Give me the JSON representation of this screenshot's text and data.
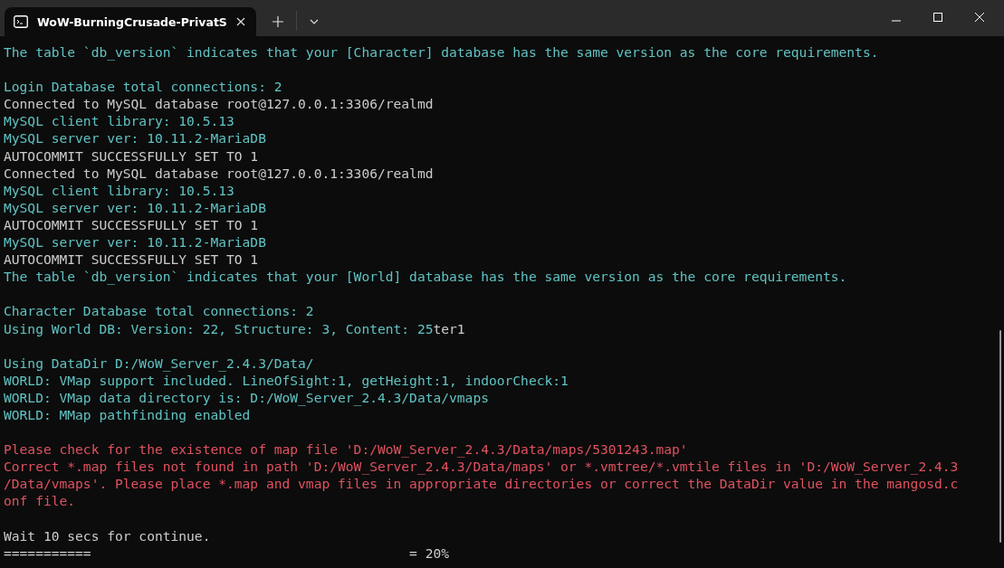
{
  "window": {
    "tab_title": "WoW-BurningCrusade-PrivatS"
  },
  "console_lines": [
    {
      "kind": "info",
      "segments": [
        {
          "text": "The table `db_version` indicates that your [Character] database has the same version as the core requirements.",
          "kind": "info"
        }
      ]
    },
    {
      "kind": "blank"
    },
    {
      "kind": "line",
      "segments": [
        {
          "text": "Login Database total connections: 2",
          "kind": "info"
        }
      ]
    },
    {
      "kind": "line",
      "segments": [
        {
          "text": "Connected to MySQL database root@127.0.0.1:3306/realmd",
          "kind": "plain"
        }
      ]
    },
    {
      "kind": "line",
      "segments": [
        {
          "text": "MySQL client library: 10.5.13",
          "kind": "info"
        }
      ]
    },
    {
      "kind": "line",
      "segments": [
        {
          "text": "MySQL server ver: 10.11.2-MariaDB",
          "kind": "info"
        }
      ]
    },
    {
      "kind": "line",
      "segments": [
        {
          "text": "AUTOCOMMIT SUCCESSFULLY SET TO 1",
          "kind": "plain"
        }
      ]
    },
    {
      "kind": "line",
      "segments": [
        {
          "text": "Connected to MySQL database root@127.0.0.1:3306/realmd",
          "kind": "plain"
        }
      ]
    },
    {
      "kind": "line",
      "segments": [
        {
          "text": "MySQL client library: 10.5.13",
          "kind": "info"
        }
      ]
    },
    {
      "kind": "line",
      "segments": [
        {
          "text": "MySQL server ver: 10.11.2-MariaDB",
          "kind": "info"
        }
      ]
    },
    {
      "kind": "line",
      "segments": [
        {
          "text": "AUTOCOMMIT SUCCESSFULLY SET TO 1",
          "kind": "plain"
        }
      ]
    },
    {
      "kind": "line",
      "segments": [
        {
          "text": "MySQL server ver: 10.11.2-MariaDB",
          "kind": "info"
        }
      ]
    },
    {
      "kind": "line",
      "segments": [
        {
          "text": "AUTOCOMMIT SUCCESSFULLY SET TO 1",
          "kind": "plain"
        }
      ]
    },
    {
      "kind": "line",
      "segments": [
        {
          "text": "The table `db_version` indicates that your [World] database has the same version as the core requirements.",
          "kind": "info"
        }
      ]
    },
    {
      "kind": "blank"
    },
    {
      "kind": "line",
      "segments": [
        {
          "text": "Character Database total connections: 2",
          "kind": "info"
        }
      ]
    },
    {
      "kind": "line",
      "segments": [
        {
          "text": "Using World DB: Version: 22, Structure: 3, Content: 25",
          "kind": "info"
        },
        {
          "text": "ter1",
          "kind": "plain"
        }
      ]
    },
    {
      "kind": "blank"
    },
    {
      "kind": "line",
      "segments": [
        {
          "text": "Using DataDir D:/WoW_Server_2.4.3/Data/",
          "kind": "info"
        }
      ]
    },
    {
      "kind": "line",
      "segments": [
        {
          "text": "WORLD: VMap support included. LineOfSight:1, getHeight:1, indoorCheck:1",
          "kind": "info"
        }
      ]
    },
    {
      "kind": "line",
      "segments": [
        {
          "text": "WORLD: VMap data directory is: D:/WoW_Server_2.4.3/Data/vmaps",
          "kind": "info"
        }
      ]
    },
    {
      "kind": "line",
      "segments": [
        {
          "text": "WORLD: MMap pathfinding enabled",
          "kind": "info"
        }
      ]
    },
    {
      "kind": "blank"
    },
    {
      "kind": "line",
      "segments": [
        {
          "text": "Please check for the existence of map file 'D:/WoW_Server_2.4.3/Data/maps/5301243.map'",
          "kind": "error"
        }
      ]
    },
    {
      "kind": "line",
      "segments": [
        {
          "text": "Correct *.map files not found in path 'D:/WoW_Server_2.4.3/Data/maps' or *.vmtree/*.vmtile files in 'D:/WoW_Server_2.4.3",
          "kind": "error"
        }
      ]
    },
    {
      "kind": "line",
      "segments": [
        {
          "text": "/Data/vmaps'. Please place *.map and vmap files in appropriate directories or correct the DataDir value in the mangosd.c",
          "kind": "error"
        }
      ]
    },
    {
      "kind": "line",
      "segments": [
        {
          "text": "onf file.",
          "kind": "error"
        }
      ]
    },
    {
      "kind": "blank"
    },
    {
      "kind": "line",
      "segments": [
        {
          "text": "Wait 10 secs for continue.",
          "kind": "plain"
        }
      ]
    },
    {
      "kind": "line",
      "segments": [
        {
          "text": "===========                                        = 20%",
          "kind": "plain"
        }
      ]
    }
  ]
}
